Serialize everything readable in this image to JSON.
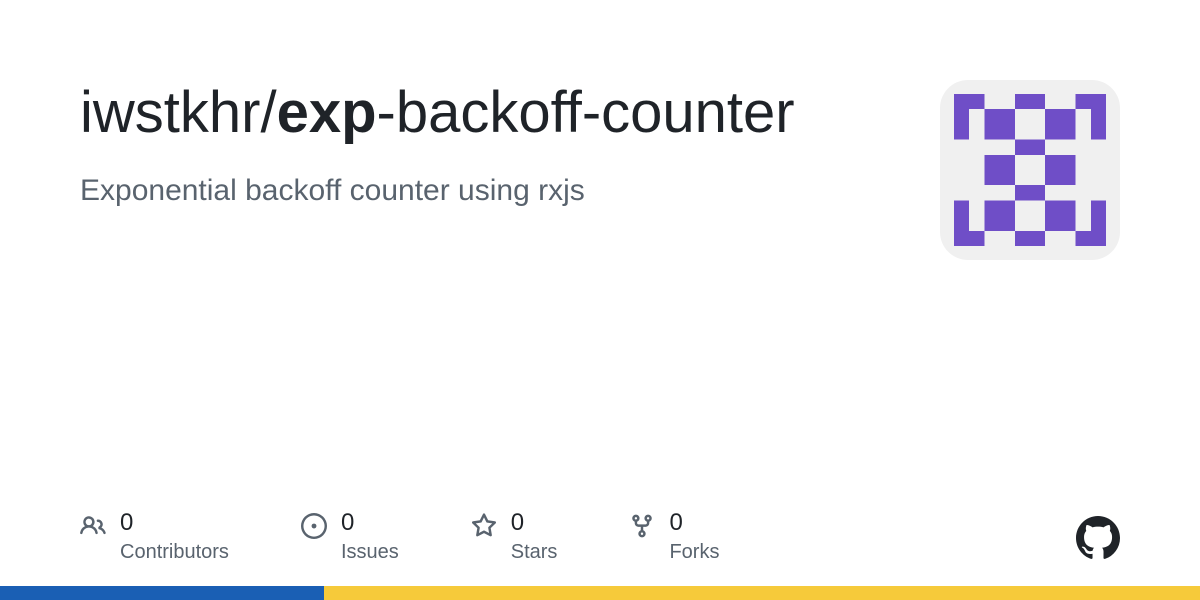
{
  "owner": "iwstkhr",
  "separator": "/",
  "repo_bold": "exp",
  "repo_rest": "-backoff-counter",
  "description": "Exponential backoff counter using rxjs",
  "stats": {
    "contributors": {
      "count": "0",
      "label": "Contributors"
    },
    "issues": {
      "count": "0",
      "label": "Issues"
    },
    "stars": {
      "count": "0",
      "label": "Stars"
    },
    "forks": {
      "count": "0",
      "label": "Forks"
    }
  },
  "colors": {
    "bar1": "#1a5fb4",
    "bar2": "#f6ca3a",
    "bar1_width": "27%",
    "bar2_width": "73%"
  }
}
